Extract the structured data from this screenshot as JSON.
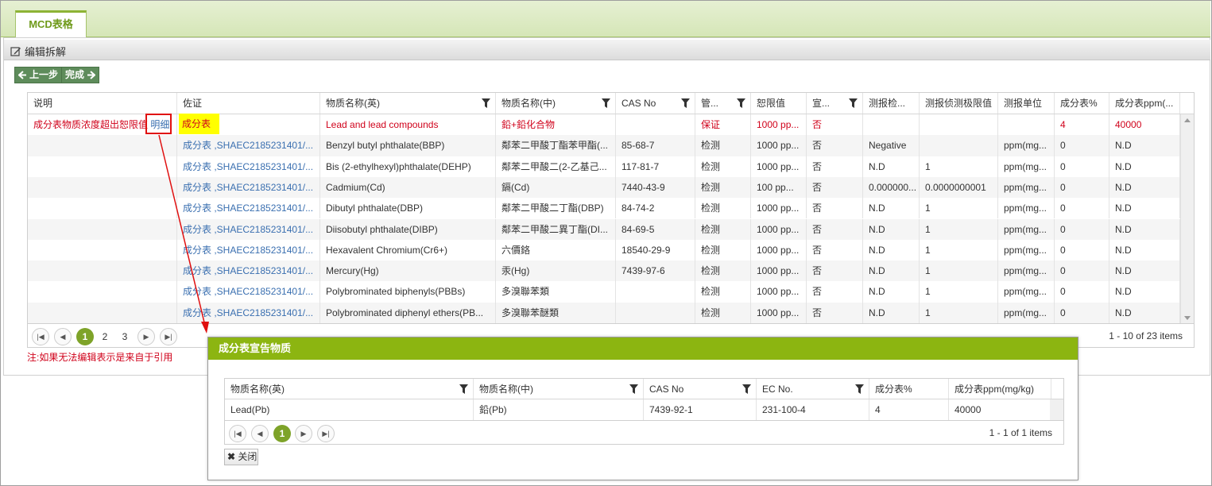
{
  "tab": {
    "label": "MCD表格"
  },
  "toolbar": {
    "edit_label": "编辑拆解",
    "prev_label": "上一步",
    "finish_label": "完成"
  },
  "grid": {
    "columns": [
      "说明",
      "佐证",
      "物质名称(英)",
      "物质名称(中)",
      "CAS No",
      "管...",
      "恕限值",
      "宣...",
      "测报检...",
      "测报侦测极限值",
      "测报单位",
      "成分表%",
      "成分表ppm(..."
    ],
    "first_row": {
      "desc": "成分表物质浓度超出恕限值",
      "detail_link": "明细",
      "evidence": "成分表",
      "name_en": "Lead and lead compounds",
      "name_cn": "鉛+鉛化合物",
      "cas": "",
      "mgmt": "保证",
      "limit": "1000 pp...",
      "declare": "否",
      "det": "",
      "det_limit": "",
      "unit": "",
      "pct": "4",
      "ppm": "40000"
    },
    "rows": [
      {
        "evidence": "成分表 ,SHAEC2185231401/...",
        "name_en": "Benzyl butyl phthalate(BBP)",
        "name_cn": "鄰苯二甲酸丁酯苯甲酯(...",
        "cas": "85-68-7",
        "mgmt": "检测",
        "limit": "1000 pp...",
        "declare": "否",
        "det": "Negative",
        "det_limit": "",
        "unit": "ppm(mg...",
        "pct": "0",
        "ppm": "N.D"
      },
      {
        "evidence": "成分表 ,SHAEC2185231401/...",
        "name_en": "Bis (2-ethylhexyl)phthalate(DEHP)",
        "name_cn": "鄰苯二甲酸二(2-乙基己...",
        "cas": "117-81-7",
        "mgmt": "检测",
        "limit": "1000 pp...",
        "declare": "否",
        "det": "N.D",
        "det_limit": "1",
        "unit": "ppm(mg...",
        "pct": "0",
        "ppm": "N.D"
      },
      {
        "evidence": "成分表 ,SHAEC2185231401/...",
        "name_en": "Cadmium(Cd)",
        "name_cn": "鎘(Cd)",
        "cas": "7440-43-9",
        "mgmt": "检测",
        "limit": "100 pp...",
        "declare": "否",
        "det": "0.000000...",
        "det_limit": "0.0000000001",
        "unit": "ppm(mg...",
        "pct": "0",
        "ppm": "N.D"
      },
      {
        "evidence": "成分表 ,SHAEC2185231401/...",
        "name_en": "Dibutyl phthalate(DBP)",
        "name_cn": "鄰苯二甲酸二丁酯(DBP)",
        "cas": "84-74-2",
        "mgmt": "检测",
        "limit": "1000 pp...",
        "declare": "否",
        "det": "N.D",
        "det_limit": "1",
        "unit": "ppm(mg...",
        "pct": "0",
        "ppm": "N.D"
      },
      {
        "evidence": "成分表 ,SHAEC2185231401/...",
        "name_en": "Diisobutyl phthalate(DIBP)",
        "name_cn": "鄰苯二甲酸二異丁酯(DI...",
        "cas": "84-69-5",
        "mgmt": "检测",
        "limit": "1000 pp...",
        "declare": "否",
        "det": "N.D",
        "det_limit": "1",
        "unit": "ppm(mg...",
        "pct": "0",
        "ppm": "N.D"
      },
      {
        "evidence": "成分表 ,SHAEC2185231401/...",
        "name_en": "Hexavalent Chromium(Cr6+)",
        "name_cn": "六價鉻",
        "cas": "18540-29-9",
        "mgmt": "检测",
        "limit": "1000 pp...",
        "declare": "否",
        "det": "N.D",
        "det_limit": "1",
        "unit": "ppm(mg...",
        "pct": "0",
        "ppm": "N.D"
      },
      {
        "evidence": "成分表 ,SHAEC2185231401/...",
        "name_en": "Mercury(Hg)",
        "name_cn": "汞(Hg)",
        "cas": "7439-97-6",
        "mgmt": "检测",
        "limit": "1000 pp...",
        "declare": "否",
        "det": "N.D",
        "det_limit": "1",
        "unit": "ppm(mg...",
        "pct": "0",
        "ppm": "N.D"
      },
      {
        "evidence": "成分表 ,SHAEC2185231401/...",
        "name_en": "Polybrominated biphenyls(PBBs)",
        "name_cn": "多溴聯苯類",
        "cas": "",
        "mgmt": "检测",
        "limit": "1000 pp...",
        "declare": "否",
        "det": "N.D",
        "det_limit": "1",
        "unit": "ppm(mg...",
        "pct": "0",
        "ppm": "N.D"
      },
      {
        "evidence": "成分表 ,SHAEC2185231401/...",
        "name_en": "Polybrominated diphenyl ethers(PB...",
        "name_cn": "多溴聯苯醚類",
        "cas": "",
        "mgmt": "检测",
        "limit": "1000 pp...",
        "declare": "否",
        "det": "N.D",
        "det_limit": "1",
        "unit": "ppm(mg...",
        "pct": "0",
        "ppm": "N.D"
      }
    ]
  },
  "pager": {
    "page1": "1",
    "page2": "2",
    "page3": "3",
    "info": "1 - 10 of 23 items"
  },
  "note": "注:如果无法编辑表示是来自于引用",
  "dialog": {
    "title": "成分表宣告物质",
    "columns": [
      "物质名称(英)",
      "物质名称(中)",
      "CAS No",
      "EC No.",
      "成分表%",
      "成分表ppm(mg/kg)"
    ],
    "row": [
      "Lead(Pb)",
      "鉛(Pb)",
      "7439-92-1",
      "231-100-4",
      "4",
      "40000"
    ],
    "pager_page": "1",
    "pager_info": "1 - 1 of 1 items",
    "close_label": "关闭"
  },
  "colors": {
    "accent": "#8cb511",
    "button": "#5e8c5b",
    "warning": "#d0021b",
    "link": "#3a6fb0"
  }
}
